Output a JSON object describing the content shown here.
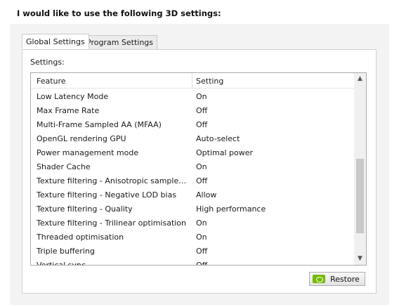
{
  "heading": "I would like to use the following 3D settings:",
  "tabs": [
    {
      "label": "Global Settings",
      "active": true
    },
    {
      "label": "Program Settings",
      "active": false
    }
  ],
  "settings_label": "Settings:",
  "columns": {
    "feature": "Feature",
    "setting": "Setting"
  },
  "rows": [
    {
      "feature": "Low Latency Mode",
      "setting": "On"
    },
    {
      "feature": "Max Frame Rate",
      "setting": "Off"
    },
    {
      "feature": "Multi-Frame Sampled AA (MFAA)",
      "setting": "Off"
    },
    {
      "feature": "OpenGL rendering GPU",
      "setting": "Auto-select"
    },
    {
      "feature": "Power management mode",
      "setting": "Optimal power"
    },
    {
      "feature": "Shader Cache",
      "setting": "On"
    },
    {
      "feature": "Texture filtering - Anisotropic sample opti...",
      "setting": "Off"
    },
    {
      "feature": "Texture filtering - Negative LOD bias",
      "setting": "Allow"
    },
    {
      "feature": "Texture filtering - Quality",
      "setting": "High performance"
    },
    {
      "feature": "Texture filtering - Trilinear optimisation",
      "setting": "On"
    },
    {
      "feature": "Threaded optimisation",
      "setting": "On"
    },
    {
      "feature": "Triple buffering",
      "setting": "Off"
    },
    {
      "feature": "Vertical sync",
      "setting": "Off"
    }
  ],
  "restore_button": "Restore",
  "colors": {
    "nvidia_green": "#76b900",
    "scroll_thumb": "#c8c8c8"
  }
}
